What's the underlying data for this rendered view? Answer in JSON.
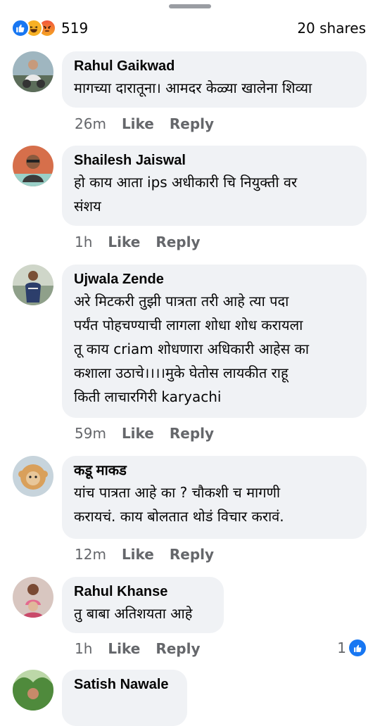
{
  "summary": {
    "reaction_count": "519",
    "shares": "20 shares"
  },
  "comments": [
    {
      "author": "Rahul Gaikwad",
      "text": "मागच्या दारातूना। आमदर केळ्या खालेना शिव्या",
      "time": "26m",
      "like_label": "Like",
      "reply_label": "Reply"
    },
    {
      "author": "Shailesh Jaiswal",
      "text": "हो काय आता ips अधीकारी चि नियुक्ती वर\nसंशय",
      "time": "1h",
      "like_label": "Like",
      "reply_label": "Reply"
    },
    {
      "author": "Ujwala Zende",
      "text": "अरे मिटकरी तुझी पात्रता तरी आहे त्या पदा\nपर्यंत पोहचण्याची लागला शोधा शोध करायला\nतू काय criam शोधणारा अधिकारी आहेस का\nकशाला उठाचे।।।।मुके घेतोस लायकीत राहू\nकिती लाचारगिरी karyachi",
      "time": "59m",
      "like_label": "Like",
      "reply_label": "Reply"
    },
    {
      "author": "कडू माकड",
      "text": "यांच पात्रता आहे का ? चौकशी च मागणी\nकरायचं. काय बोलतात थोडं विचार करावं.",
      "time": "12m",
      "like_label": "Like",
      "reply_label": "Reply"
    },
    {
      "author": "Rahul Khanse",
      "text": "तु बाबा अतिशयता आहे",
      "time": "1h",
      "like_label": "Like",
      "reply_label": "Reply",
      "like_count": "1"
    },
    {
      "author": "Satish Nawale"
    }
  ],
  "colors": {
    "like_blue": "#1877f2",
    "bubble_bg": "#f0f2f5",
    "meta_gray": "#65676b"
  },
  "icons": [
    "like-reaction-icon",
    "haha-reaction-icon",
    "angry-reaction-icon"
  ]
}
